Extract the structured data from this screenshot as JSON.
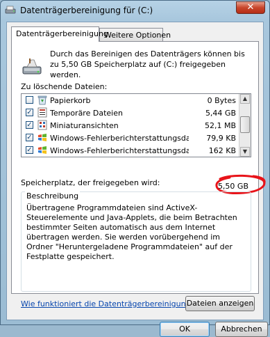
{
  "window": {
    "title": "Datenträgerbereinigung für  (C:)",
    "close_glyph": "✕"
  },
  "tabs": [
    {
      "label": "Datenträgerbereinigung"
    },
    {
      "label": "Weitere Optionen"
    }
  ],
  "intro_text": "Durch das Bereinigen des Datenträgers können bis zu 5,50 GB Speicherplatz auf  (C:) freigegeben werden.",
  "files_label": "Zu löschende Dateien:",
  "files": [
    {
      "name": "Papierkorb",
      "size": "0 Bytes",
      "checked": false,
      "icon": "recycle-bin-icon"
    },
    {
      "name": "Temporäre Dateien",
      "size": "5,44 GB",
      "checked": true,
      "icon": "temp-files-icon"
    },
    {
      "name": "Miniaturansichten",
      "size": "52,1 MB",
      "checked": true,
      "icon": "thumbnails-icon"
    },
    {
      "name": "Windows-Fehlerberichterstattungsdatei...",
      "size": "79,9 KB",
      "checked": true,
      "icon": "windows-logo-icon"
    },
    {
      "name": "Windows-Fehlerberichterstattungsdatei...",
      "size": "162 KB",
      "checked": true,
      "icon": "windows-logo-icon"
    }
  ],
  "space_label": "Speicherplatz, der freigegeben wird:",
  "space_value": "5,50 GB",
  "description": {
    "legend": "Beschreibung",
    "text": "Übertragene Programmdateien sind ActiveX-Steuerelemente und Java-Applets, die beim Betrachten bestimmter Seiten automatisch aus dem Internet übertragen werden. Sie werden vorübergehend im Ordner \"Heruntergeladene Programmdateien\" auf der Festplatte gespeichert."
  },
  "buttons": {
    "view_files": "Dateien anzeigen",
    "ok": "OK",
    "cancel": "Abbrechen"
  },
  "help_link": "Wie funktioniert die Datenträgerbereinigung?",
  "colors": {
    "accent": "#0645ad",
    "annotation": "#e8141a"
  }
}
